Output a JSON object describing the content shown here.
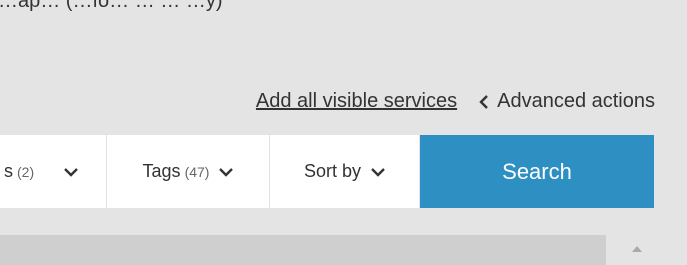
{
  "header": {
    "top_text": "…ap… (…fo… … … …y)"
  },
  "actions": {
    "add_all_label": "Add all visible services",
    "advanced_label": "Advanced actions"
  },
  "filters": [
    {
      "label": "s",
      "count": "(2)",
      "icon": "chevron-down-icon"
    },
    {
      "label": "Tags",
      "count": "(47)",
      "icon": "chevron-down-icon"
    },
    {
      "label": "Sort by",
      "count": "",
      "icon": "chevron-down-icon"
    }
  ],
  "search": {
    "label": "Search",
    "color": "#2e8fc2"
  },
  "icons": {
    "advanced": "chevron-left-icon",
    "scroll": "scroll-up-arrow-icon"
  }
}
